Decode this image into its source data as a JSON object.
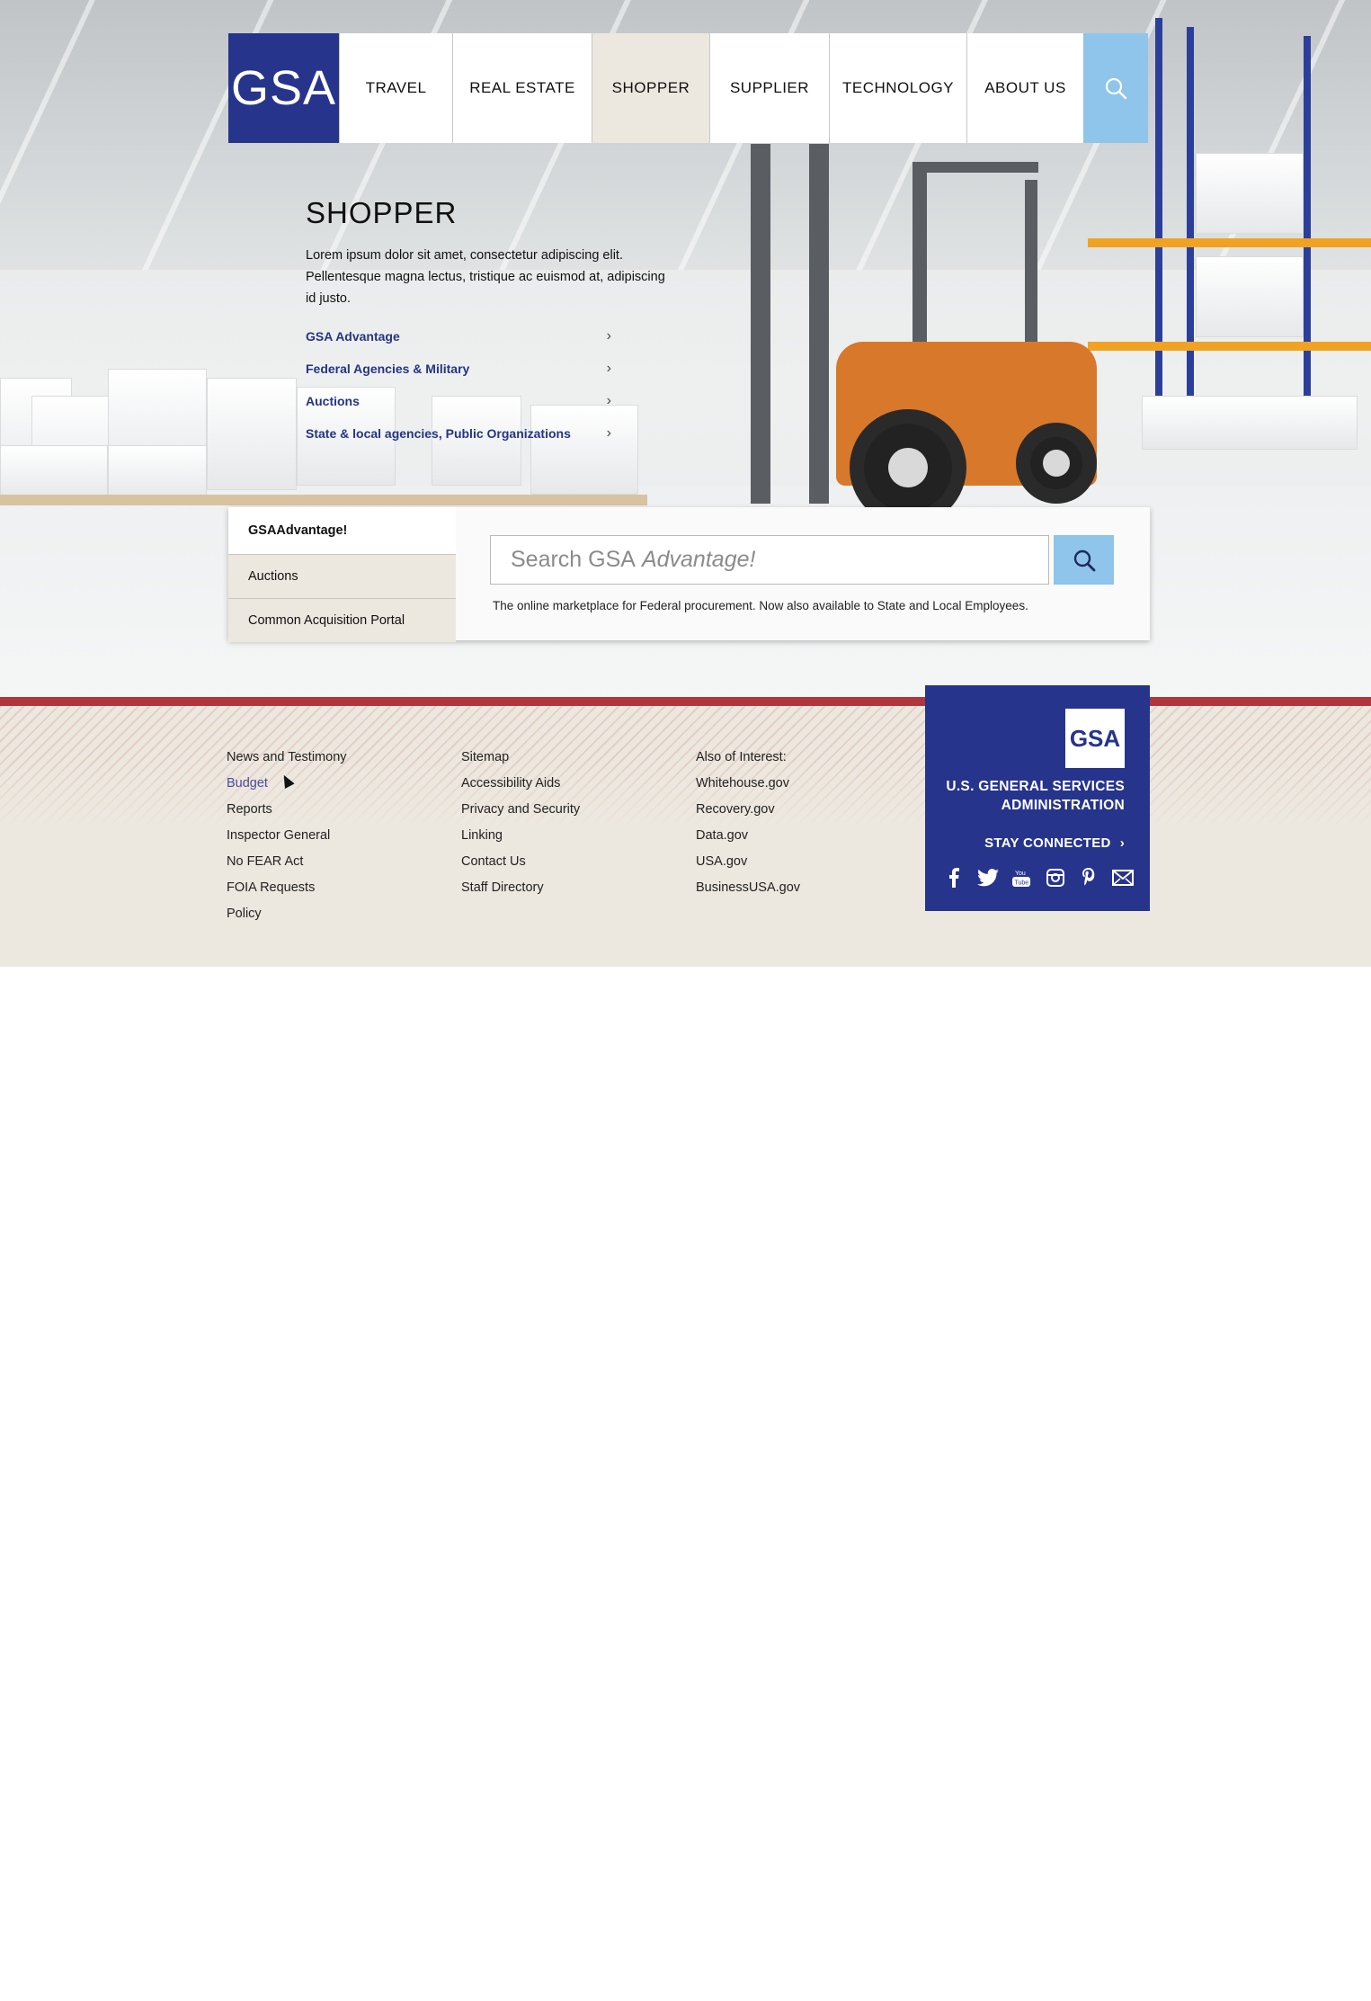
{
  "header": {
    "logo_text": "GSA",
    "nav": [
      {
        "label": "TRAVEL",
        "active": false
      },
      {
        "label": "REAL ESTATE",
        "active": false
      },
      {
        "label": "SHOPPER",
        "active": true
      },
      {
        "label": "SUPPLIER",
        "active": false
      },
      {
        "label": "TECHNOLOGY",
        "active": false
      },
      {
        "label": "ABOUT US",
        "active": false
      }
    ],
    "search_icon": "search-icon"
  },
  "intro": {
    "title": "SHOPPER",
    "text": "Lorem ipsum dolor sit amet, consectetur adipiscing elit. Pellentesque magna lectus, tristique ac euismod at, adipiscing id justo.",
    "links": [
      "GSA Advantage",
      "Federal Agencies & Military",
      "Auctions",
      "State & local agencies, Public Organizations"
    ]
  },
  "search_panel": {
    "tabs": [
      "GSAAdvantage!",
      "Auctions",
      "Common Acquisition Portal"
    ],
    "active_tab": "GSAAdvantage!",
    "placeholder_prefix": "Search GSA",
    "placeholder_italic": "Advantage!",
    "note": "The online marketplace for Federal procurement. Now also available to State and Local Employees."
  },
  "footer": {
    "col1": [
      "News and Testimony",
      "Budget",
      "Reports",
      "Inspector General",
      "No FEAR Act",
      "FOIA Requests",
      "Policy"
    ],
    "col2": [
      "Sitemap",
      "Accessibility Aids",
      "Privacy and Security",
      "Linking",
      "Contact Us",
      "Staff Directory"
    ],
    "col3": [
      "Also of Interest:",
      "Whitehouse.gov",
      "Recovery.gov",
      "Data.gov",
      "USA.gov",
      "BusinessUSA.gov"
    ],
    "agency": {
      "logo_text": "GSA",
      "name_line1": "U.S. GENERAL SERVICES",
      "name_line2": "ADMINISTRATION",
      "stay_connected": "STAY CONNECTED",
      "socials": [
        "facebook-icon",
        "twitter-icon",
        "youtube-icon",
        "instagram-icon",
        "pinterest-icon",
        "email-icon"
      ]
    }
  },
  "colors": {
    "brand_navy": "#26348b",
    "accent_blue": "#8fc4eb",
    "footer_red": "#b0363c",
    "footer_bg": "#ede8df",
    "link_navy": "#243582"
  }
}
